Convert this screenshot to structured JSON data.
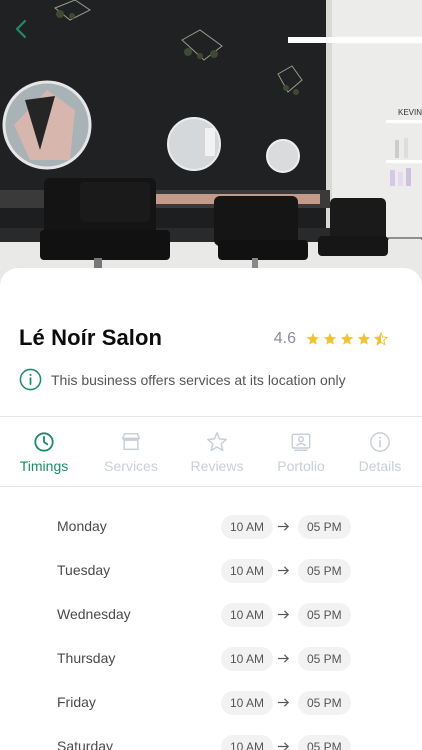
{
  "salon": {
    "name": "Lé Noír Salon",
    "rating": "4.6",
    "stars": {
      "full": 4,
      "half": 1,
      "total": 5
    },
    "info_text": "This business offers services at its location only"
  },
  "hero": {
    "wall_sign": "KEVIN"
  },
  "tabs": [
    {
      "label": "Timings",
      "icon": "clock-icon",
      "active": true
    },
    {
      "label": "Services",
      "icon": "storefront-icon",
      "active": false
    },
    {
      "label": "Reviews",
      "icon": "star-outline-icon",
      "active": false
    },
    {
      "label": "Portolio",
      "icon": "portfolio-icon",
      "active": false
    },
    {
      "label": "Details",
      "icon": "info-icon",
      "active": false
    }
  ],
  "timings": [
    {
      "day": "Monday",
      "open": "10 AM",
      "close": "05 PM"
    },
    {
      "day": "Tuesday",
      "open": "10 AM",
      "close": "05 PM"
    },
    {
      "day": "Wednesday",
      "open": "10 AM",
      "close": "05 PM"
    },
    {
      "day": "Thursday",
      "open": "10 AM",
      "close": "05 PM"
    },
    {
      "day": "Friday",
      "open": "10 AM",
      "close": "05 PM"
    },
    {
      "day": "Saturday",
      "open": "10 AM",
      "close": "05 PM"
    }
  ],
  "colors": {
    "accent": "#1f8a66",
    "star": "#f1c232",
    "rating_text": "#8d8aa8",
    "tab_inactive": "#c9cfd8",
    "pill_bg": "#f2f2f2"
  }
}
